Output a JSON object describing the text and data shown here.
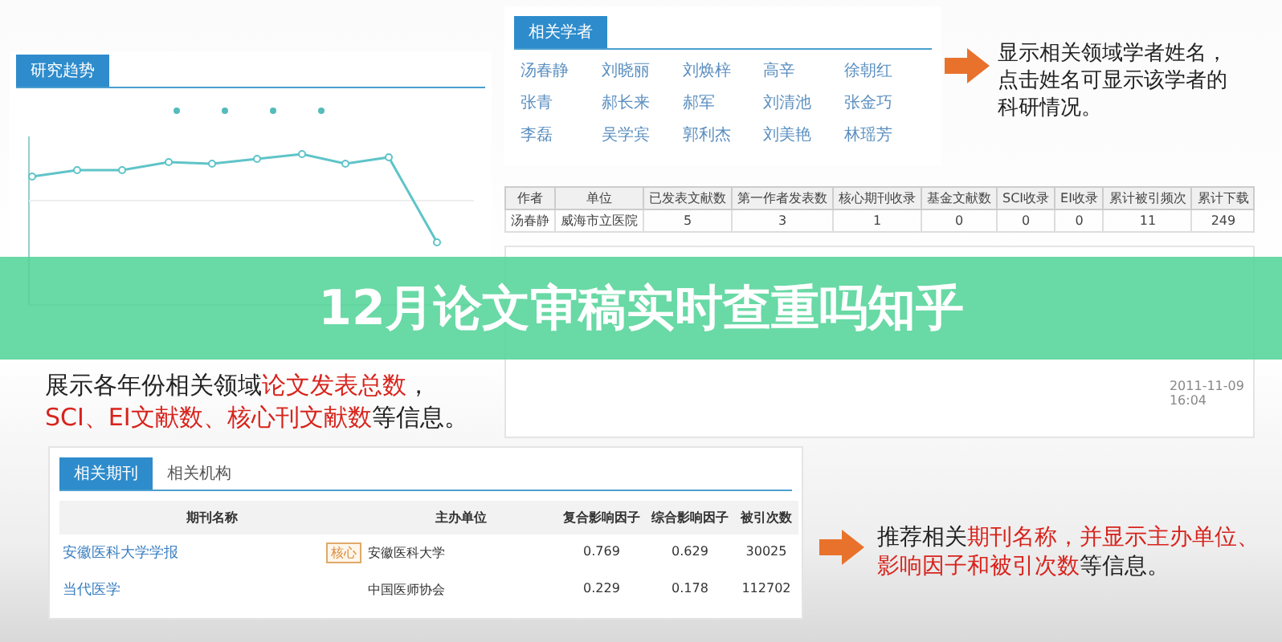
{
  "banner": {
    "title": "12月论文审稿实时查重吗知乎"
  },
  "trend_panel": {
    "tabs": [
      {
        "label": "研究趋势",
        "selected": true
      }
    ]
  },
  "scholars_panel": {
    "tabs": [
      {
        "label": "相关学者",
        "selected": true
      }
    ],
    "names": [
      "汤春静",
      "刘晓丽",
      "刘焕梓",
      "高辛",
      "徐朝红",
      "张青",
      "郝长来",
      "郝军",
      "刘清池",
      "张金巧",
      "李磊",
      "吴学宾",
      "郭利杰",
      "刘美艳",
      "林瑶芳"
    ]
  },
  "stats_table": {
    "columns": [
      "作者",
      "单位",
      "已发表文献数",
      "第一作者发表数",
      "核心期刊收录",
      "基金文献数",
      "SCI收录",
      "EI收录",
      "累计被引频次",
      "累计下载"
    ],
    "rows": [
      [
        "汤春静",
        "威海市立医院",
        "5",
        "3",
        "1",
        "0",
        "0",
        "0",
        "11",
        "249"
      ]
    ]
  },
  "papers_panel": {
    "dates": [
      {
        "date": "2011-11-09",
        "time": "16:04"
      }
    ]
  },
  "journals_panel": {
    "tabs": [
      {
        "label": "相关期刊",
        "selected": true
      },
      {
        "label": "相关机构",
        "selected": false
      }
    ],
    "columns": [
      "期刊名称",
      "主办单位",
      "复合影响因子",
      "综合影响因子",
      "被引次数"
    ],
    "rows": [
      {
        "name": "安徽医科大学学报",
        "badge": "核心",
        "publisher": "安徽医科大学",
        "composite": "0.769",
        "comprehensive": "0.629",
        "citations": "30025"
      },
      {
        "name": "当代医学",
        "publisher": "中国医师协会",
        "composite": "0.229",
        "comprehensive": "0.178",
        "citations": "112702"
      }
    ]
  },
  "notes": [
    {
      "text": "显示相关领域学者姓名，点击姓名可显示该学者的科研情况。"
    },
    {
      "text": "展示各年份相关领域**论文发表总数**，**SCI、EI文献数、核心刊文献数**等信息。"
    },
    {
      "text": "推荐相关**期刊名称，并显示主办单位、影响因子和被引次数**等信息。"
    }
  ]
}
